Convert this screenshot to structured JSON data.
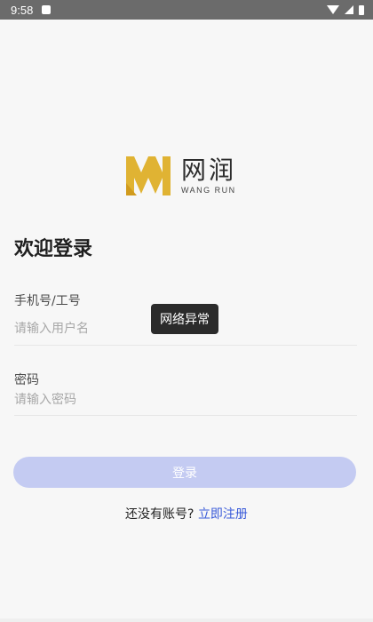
{
  "status_bar": {
    "time": "9:58"
  },
  "brand": {
    "name_cn": "网润",
    "name_en": "WANG RUN",
    "logo_color": "#e0b333"
  },
  "title": "欢迎登录",
  "form": {
    "username": {
      "label": "手机号/工号",
      "placeholder": "请输入用户名",
      "value": ""
    },
    "password": {
      "label": "密码",
      "placeholder": "请输入密码",
      "value": ""
    }
  },
  "toast": "网络异常",
  "login_button": {
    "label": "登录",
    "color": "#c4cbf2"
  },
  "register": {
    "question": "还没有账号?",
    "link": "立即注册",
    "link_color": "#3a5bd9"
  }
}
